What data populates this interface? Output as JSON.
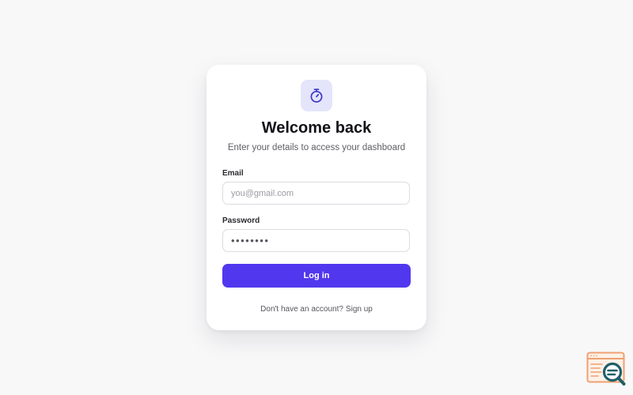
{
  "login": {
    "logo_icon": "stopwatch-icon",
    "title": "Welcome back",
    "subtitle": "Enter your details to access your dashboard",
    "email": {
      "label": "Email",
      "placeholder": "you@gmail.com",
      "value": ""
    },
    "password": {
      "label": "Password",
      "value": "••••••••"
    },
    "submit_label": "Log in",
    "footer_prompt": "Don't have an account?",
    "signup_label": "Sign up"
  },
  "corner_badge": {
    "icon": "browser-search-icon"
  },
  "colors": {
    "page_background": "#f8f8f9",
    "card_background": "#ffffff",
    "accent": "#5138ee",
    "logo_tile": "#e4e5fb",
    "logo_stroke": "#3a36c9",
    "badge_orange": "#f0a070",
    "badge_teal": "#1f5f68"
  }
}
